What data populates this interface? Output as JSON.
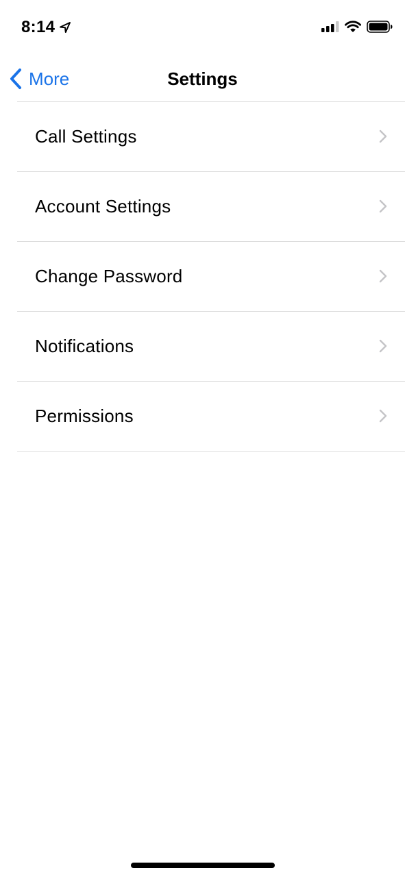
{
  "status_bar": {
    "time": "8:14",
    "icons": [
      "location-arrow-icon",
      "cellular-signal-icon",
      "wifi-icon",
      "battery-icon"
    ]
  },
  "nav": {
    "back_label": "More",
    "title": "Settings"
  },
  "settings": {
    "items": [
      {
        "label": "Call Settings"
      },
      {
        "label": "Account Settings"
      },
      {
        "label": "Change Password"
      },
      {
        "label": "Notifications"
      },
      {
        "label": "Permissions"
      }
    ]
  },
  "colors": {
    "accent": "#1a73e8",
    "separator": "#dcdcdc",
    "chevron": "#c4c4c7",
    "background": "#ffffff"
  }
}
